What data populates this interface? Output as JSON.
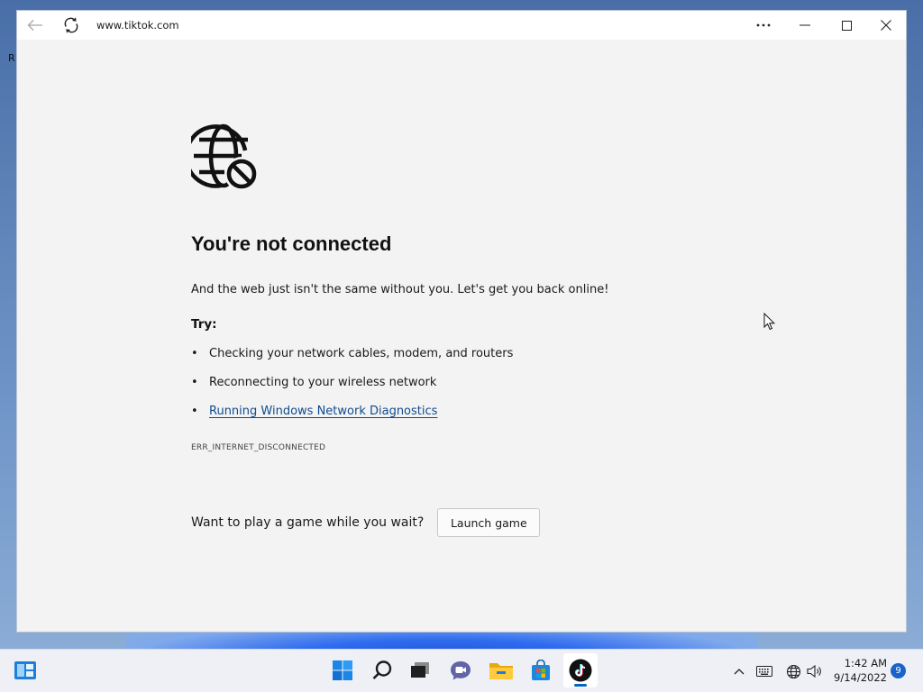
{
  "desktop": {
    "letter": "R"
  },
  "browser": {
    "url": "www.tiktok.com",
    "icons": {
      "back": "back-arrow-icon",
      "refresh": "refresh-icon",
      "more": "more-icon",
      "minimize": "minimize-icon",
      "maximize": "maximize-icon",
      "close": "close-icon"
    }
  },
  "error_page": {
    "icon": "globe-blocked-icon",
    "heading": "You're not connected",
    "subtext": "And the web just isn't the same without you. Let's get you back online!",
    "try_label": "Try:",
    "tips": [
      "Checking your network cables, modem, and routers",
      "Reconnecting to your wireless network"
    ],
    "diagnostics_link": "Running Windows Network Diagnostics",
    "bullet": "•",
    "error_code": "ERR_INTERNET_DISCONNECTED",
    "game_prompt": "Want to play a game while you wait?",
    "game_button": "Launch game"
  },
  "taskbar": {
    "apps": [
      "widgets-icon",
      "windows-start-icon",
      "search-icon",
      "task-view-icon",
      "chat-icon",
      "file-explorer-icon",
      "store-icon",
      "tiktok-icon"
    ],
    "accent": "#0067c0",
    "time": "1:42 AM",
    "date": "9/14/2022",
    "notification_count": "9"
  }
}
